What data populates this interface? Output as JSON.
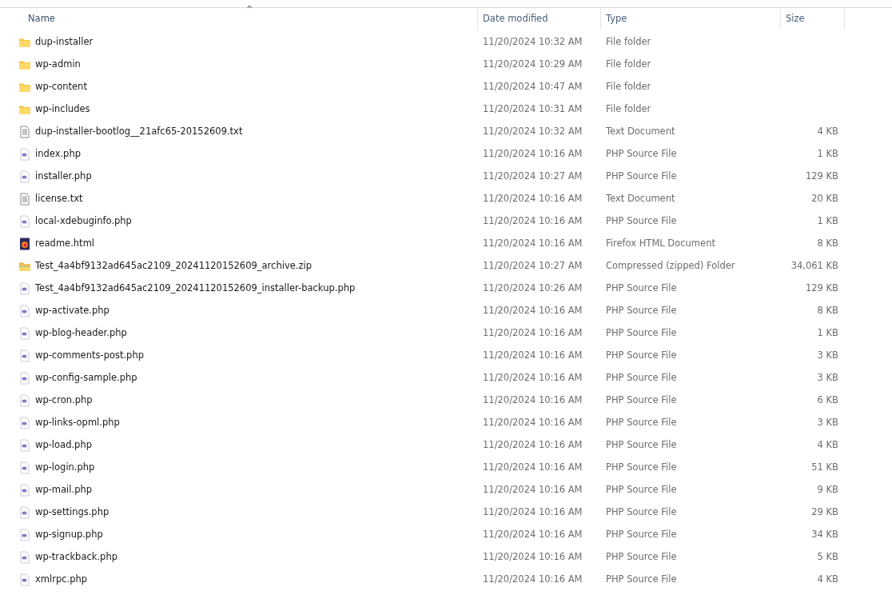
{
  "columns": [
    {
      "label": "Name",
      "sorted": true
    },
    {
      "label": "Date modified",
      "sorted": false
    },
    {
      "label": "Type",
      "sorted": false
    },
    {
      "label": "Size",
      "sorted": false
    }
  ],
  "sort_indicator": "^",
  "files": [
    {
      "kind": "folder",
      "name": "dup-installer",
      "date": "11/20/2024 10:32 AM",
      "type": "File folder"
    },
    {
      "kind": "folder",
      "name": "wp-admin",
      "date": "11/20/2024 10:29 AM",
      "type": "File folder"
    },
    {
      "kind": "folder",
      "name": "wp-content",
      "date": "11/20/2024 10:47 AM",
      "type": "File folder"
    },
    {
      "kind": "folder",
      "name": "wp-includes",
      "date": "11/20/2024 10:31 AM",
      "type": "File folder"
    },
    {
      "kind": "text",
      "name": "dup-installer-bootlog__21afc65-20152609.txt",
      "date": "11/20/2024 10:32 AM",
      "type": "Text Document",
      "size": "4 KB"
    },
    {
      "kind": "php",
      "name": "index.php",
      "date": "11/20/2024 10:16 AM",
      "type": "PHP Source File",
      "size": "1 KB"
    },
    {
      "kind": "php",
      "name": "installer.php",
      "date": "11/20/2024 10:27 AM",
      "type": "PHP Source File",
      "size": "129 KB"
    },
    {
      "kind": "text",
      "name": "license.txt",
      "date": "11/20/2024 10:16 AM",
      "type": "Text Document",
      "size": "20 KB"
    },
    {
      "kind": "php",
      "name": "local-xdebuginfo.php",
      "date": "11/20/2024 10:16 AM",
      "type": "PHP Source File",
      "size": "1 KB"
    },
    {
      "kind": "html",
      "name": "readme.html",
      "date": "11/20/2024 10:16 AM",
      "type": "Firefox HTML Document",
      "size": "8 KB"
    },
    {
      "kind": "zip",
      "name": "Test_4a4bf9132ad645ac2109_20241120152609_archive.zip",
      "date": "11/20/2024 10:27 AM",
      "type": "Compressed (zipped) Folder",
      "size": "34,061 KB"
    },
    {
      "kind": "php",
      "name": "Test_4a4bf9132ad645ac2109_20241120152609_installer-backup.php",
      "date": "11/20/2024 10:26 AM",
      "type": "PHP Source File",
      "size": "129 KB"
    },
    {
      "kind": "php",
      "name": "wp-activate.php",
      "date": "11/20/2024 10:16 AM",
      "type": "PHP Source File",
      "size": "8 KB"
    },
    {
      "kind": "php",
      "name": "wp-blog-header.php",
      "date": "11/20/2024 10:16 AM",
      "type": "PHP Source File",
      "size": "1 KB"
    },
    {
      "kind": "php",
      "name": "wp-comments-post.php",
      "date": "11/20/2024 10:16 AM",
      "type": "PHP Source File",
      "size": "3 KB"
    },
    {
      "kind": "php",
      "name": "wp-config-sample.php",
      "date": "11/20/2024 10:16 AM",
      "type": "PHP Source File",
      "size": "3 KB"
    },
    {
      "kind": "php",
      "name": "wp-cron.php",
      "date": "11/20/2024 10:16 AM",
      "type": "PHP Source File",
      "size": "6 KB"
    },
    {
      "kind": "php",
      "name": "wp-links-opml.php",
      "date": "11/20/2024 10:16 AM",
      "type": "PHP Source File",
      "size": "3 KB"
    },
    {
      "kind": "php",
      "name": "wp-load.php",
      "date": "11/20/2024 10:16 AM",
      "type": "PHP Source File",
      "size": "4 KB"
    },
    {
      "kind": "php",
      "name": "wp-login.php",
      "date": "11/20/2024 10:16 AM",
      "type": "PHP Source File",
      "size": "51 KB"
    },
    {
      "kind": "php",
      "name": "wp-mail.php",
      "date": "11/20/2024 10:16 AM",
      "type": "PHP Source File",
      "size": "9 KB"
    },
    {
      "kind": "php",
      "name": "wp-settings.php",
      "date": "11/20/2024 10:16 AM",
      "type": "PHP Source File",
      "size": "29 KB"
    },
    {
      "kind": "php",
      "name": "wp-signup.php",
      "date": "11/20/2024 10:16 AM",
      "type": "PHP Source File",
      "size": "34 KB"
    },
    {
      "kind": "php",
      "name": "wp-trackback.php",
      "date": "11/20/2024 10:16 AM",
      "type": "PHP Source File",
      "size": "5 KB"
    },
    {
      "kind": "php",
      "name": "xmlrpc.php",
      "date": "11/20/2024 10:16 AM",
      "type": "PHP Source File",
      "size": "4 KB"
    }
  ]
}
